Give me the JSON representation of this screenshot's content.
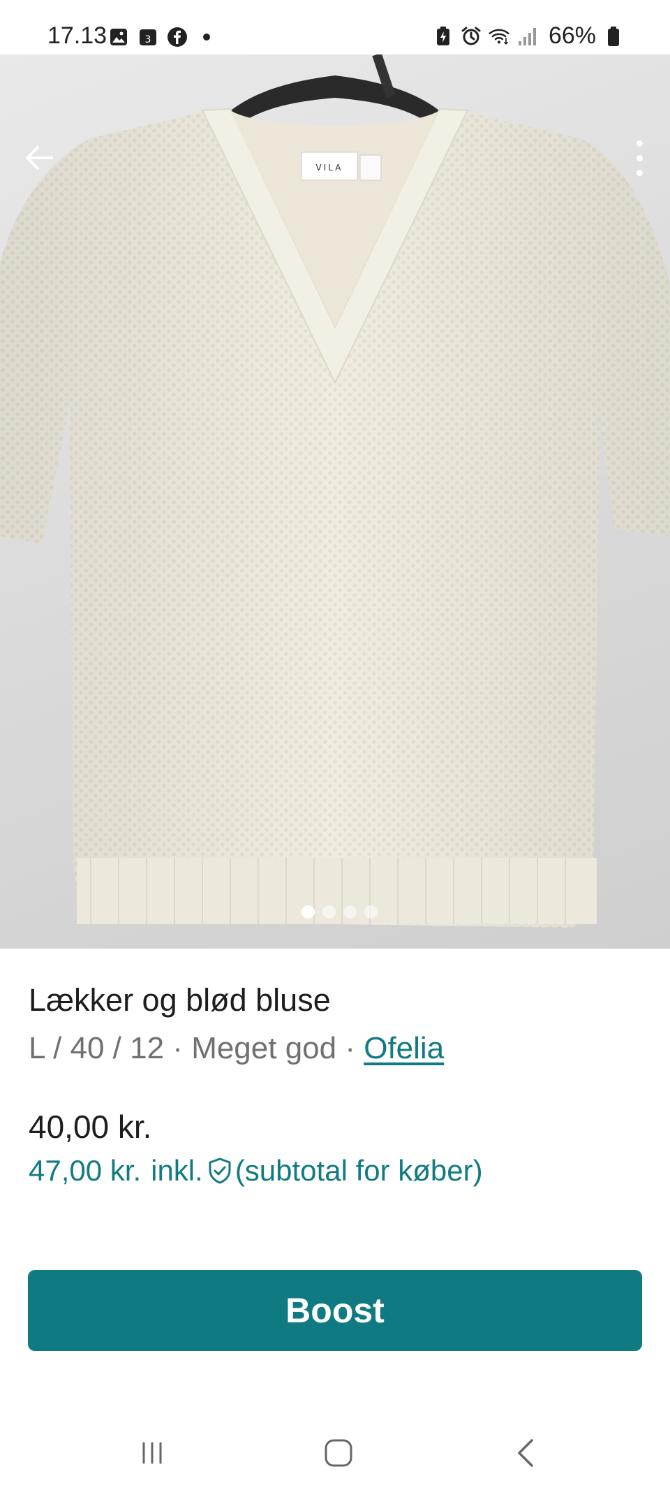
{
  "status_bar": {
    "time": "17.13",
    "calendar_day": "3",
    "battery": "66%",
    "left_icons": [
      "gallery-icon",
      "calendar-icon",
      "facebook-icon",
      "notification-dot-icon"
    ],
    "right_icons": [
      "battery-saver-icon",
      "alarm-icon",
      "wifi-icon",
      "signal-icon",
      "battery-icon"
    ]
  },
  "product_image": {
    "page_count": 4,
    "active_page": 1,
    "label_text": "VILA"
  },
  "product": {
    "title": "Lækker og blød bluse",
    "size": "L / 40 / 12",
    "separator": " · ",
    "condition": "Meget god",
    "brand": "Ofelia",
    "price": "40,00 kr.",
    "total_amount": "47,00 kr.",
    "total_inkl": "inkl.",
    "total_suffix": "(subtotal for køber)"
  },
  "actions": {
    "boost_label": "Boost"
  },
  "colors": {
    "accent": "#127b82",
    "button": "#107a82",
    "text_primary": "#1d1d1d",
    "text_secondary": "#707070"
  }
}
